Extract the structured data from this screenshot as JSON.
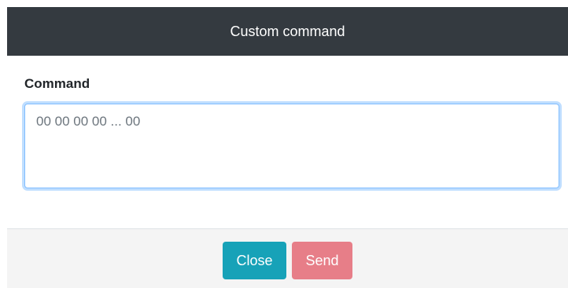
{
  "modal": {
    "title": "Custom command",
    "field_label": "Command",
    "field_placeholder": "00 00 00 00 ... 00",
    "field_value": ""
  },
  "footer": {
    "close_label": "Close",
    "send_label": "Send"
  },
  "colors": {
    "header_bg": "#343a40",
    "close_button": "#17a2b8",
    "send_button_disabled": "#e77e88",
    "focus_border": "#80bdff"
  }
}
